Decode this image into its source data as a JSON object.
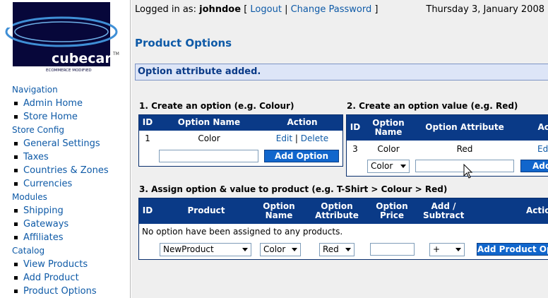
{
  "brand": {
    "logo_text": "cubecart",
    "logo_tm": "TM",
    "logo_tagline": "ECOMMERCE MODIFIED"
  },
  "sidebar": {
    "sections": [
      {
        "title": "Navigation",
        "items": [
          "Admin Home",
          "Store Home"
        ]
      },
      {
        "title": "Store Config",
        "items": [
          "General Settings",
          "Taxes",
          "Countries & Zones",
          "Currencies"
        ]
      },
      {
        "title": "Modules",
        "items": [
          "Shipping",
          "Gateways",
          "Affiliates"
        ]
      },
      {
        "title": "Catalog",
        "items": [
          "View Products",
          "Add Product",
          "Product Options"
        ]
      }
    ]
  },
  "header": {
    "logged_in_label": "Logged in as:",
    "username": "johndoe",
    "bracket_open": "[",
    "logout": "Logout",
    "separator": "|",
    "change_password": "Change Password",
    "bracket_close": "]",
    "date": "Thursday 3, January 2008"
  },
  "page": {
    "title": "Product Options",
    "flash": "Option attribute added."
  },
  "section1": {
    "title": "1. Create an option (e.g. Colour)",
    "headers": [
      "ID",
      "Option Name",
      "Action"
    ],
    "row": {
      "id": "1",
      "name": "Color",
      "edit": "Edit",
      "sep": "|",
      "delete": "Delete"
    },
    "input_value": "",
    "button": "Add Option"
  },
  "section2": {
    "title": "2. Create an option value (e.g. Red)",
    "headers": [
      "ID",
      "Option Name",
      "Option Attribute",
      "Action"
    ],
    "row": {
      "id": "3",
      "name": "Color",
      "attribute": "Red",
      "edit": "Edit"
    },
    "select_value": "Color",
    "input_value": "",
    "button": "Add Value"
  },
  "section3": {
    "title": "3. Assign option & value to product (e.g. T-Shirt > Colour > Red)",
    "headers": [
      "ID",
      "Product",
      "Option Name",
      "Option Attribute",
      "Option Price",
      "Add / Subtract",
      "Action"
    ],
    "empty_message": "No option have been assigned to any products.",
    "product_select": "NewProduct",
    "option_select": "Color",
    "attribute_select": "Red",
    "price_value": "",
    "sign_select": "+",
    "button": "Add Product Option"
  },
  "colors": {
    "link": "#0e5aa7",
    "table_header": "#0a3a87",
    "button": "#1166cc",
    "flash_bg": "#dde5f7"
  }
}
